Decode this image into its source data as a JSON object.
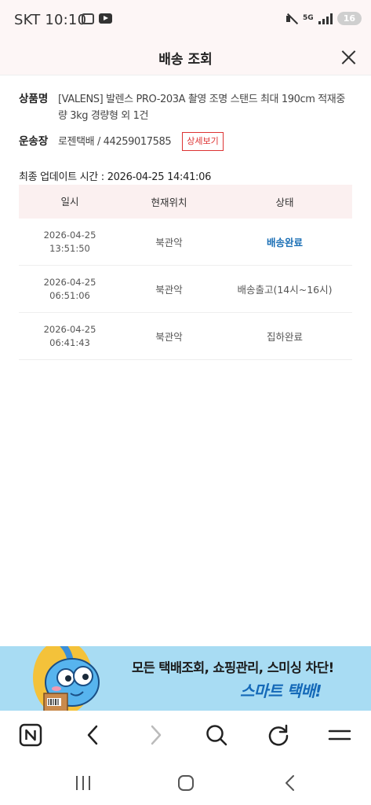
{
  "status_bar": {
    "carrier_time": "SKT 10:10",
    "network": "5G",
    "battery": "16"
  },
  "header": {
    "title": "배송 조회"
  },
  "product": {
    "label": "상품명",
    "value_line1": "[VALENS] 발렌스 PRO-203A 촬영 조명 스탠드 최대 190cm 적재중",
    "value_line2": "량 3kg 경량형 외 1건"
  },
  "invoice": {
    "label": "운송장",
    "value": "로젠택배 / 44259017585",
    "detail_button": "상세보기"
  },
  "last_update": "최종 업데이트 시간 : 2026-04-25 14:41:06",
  "table": {
    "headers": [
      "일시",
      "현재위치",
      "상태"
    ],
    "rows": [
      {
        "date": "2026-04-25",
        "time": "13:51:50",
        "location": "북관악",
        "status": "배송완료"
      },
      {
        "date": "2026-04-25",
        "time": "06:51:06",
        "location": "북관악",
        "status": "배송출고(14시~16시)"
      },
      {
        "date": "2026-04-25",
        "time": "06:41:43",
        "location": "북관악",
        "status": "집하완료"
      }
    ]
  },
  "banner": {
    "line1": "모든 택배조회, 쇼핑관리, 스미싱 차단!",
    "line2": "스마트 택배!"
  },
  "colors": {
    "accent_red": "#dd3333",
    "status_blue": "#1b6fb5",
    "banner_bg": "#a8dcf3",
    "header_bg": "#fdf6f6"
  },
  "icons": {
    "browser": [
      "n-home-icon",
      "back-arrow-icon",
      "forward-arrow-icon",
      "search-icon",
      "refresh-icon",
      "menu-icon"
    ],
    "system": [
      "recent-apps-icon",
      "home-icon",
      "back-icon"
    ]
  }
}
